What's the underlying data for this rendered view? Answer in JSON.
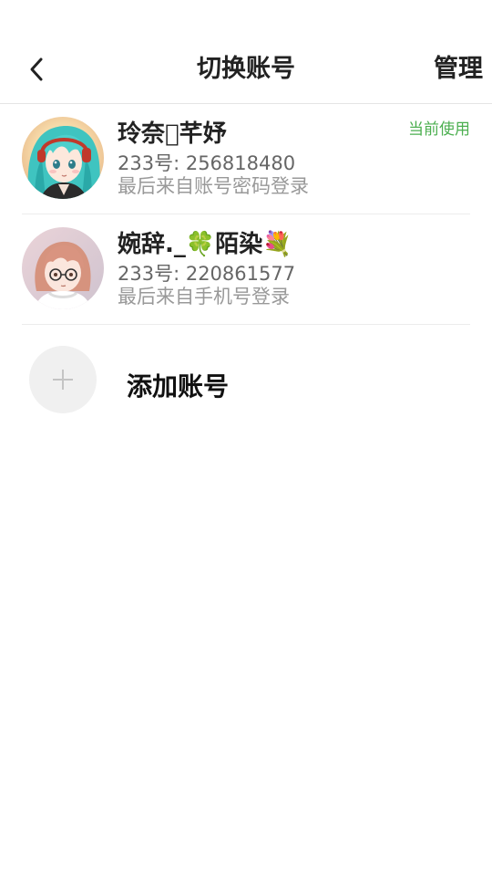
{
  "header": {
    "title": "切换账号",
    "manage_label": "管理",
    "back_icon": "chevron-left-icon"
  },
  "accounts": [
    {
      "name": "玲奈\u0000芊妤",
      "uid": "233号: 256818480",
      "login": "最后来自账号密码登录",
      "current_label": "当前使用",
      "is_current": true,
      "avatar_icon": "anime-girl-teal-hair-avatar"
    },
    {
      "name": "婉辞._🍀陌染💐",
      "uid": "233号: 220861577",
      "login": "最后来自手机号登录",
      "is_current": false,
      "avatar_icon": "anime-girl-glasses-avatar"
    }
  ],
  "add_account": {
    "label": "添加账号",
    "icon": "plus-icon"
  },
  "colors": {
    "current_green": "#4caf50",
    "text_dark": "#222222",
    "text_gray": "#666666",
    "text_light": "#999999"
  }
}
